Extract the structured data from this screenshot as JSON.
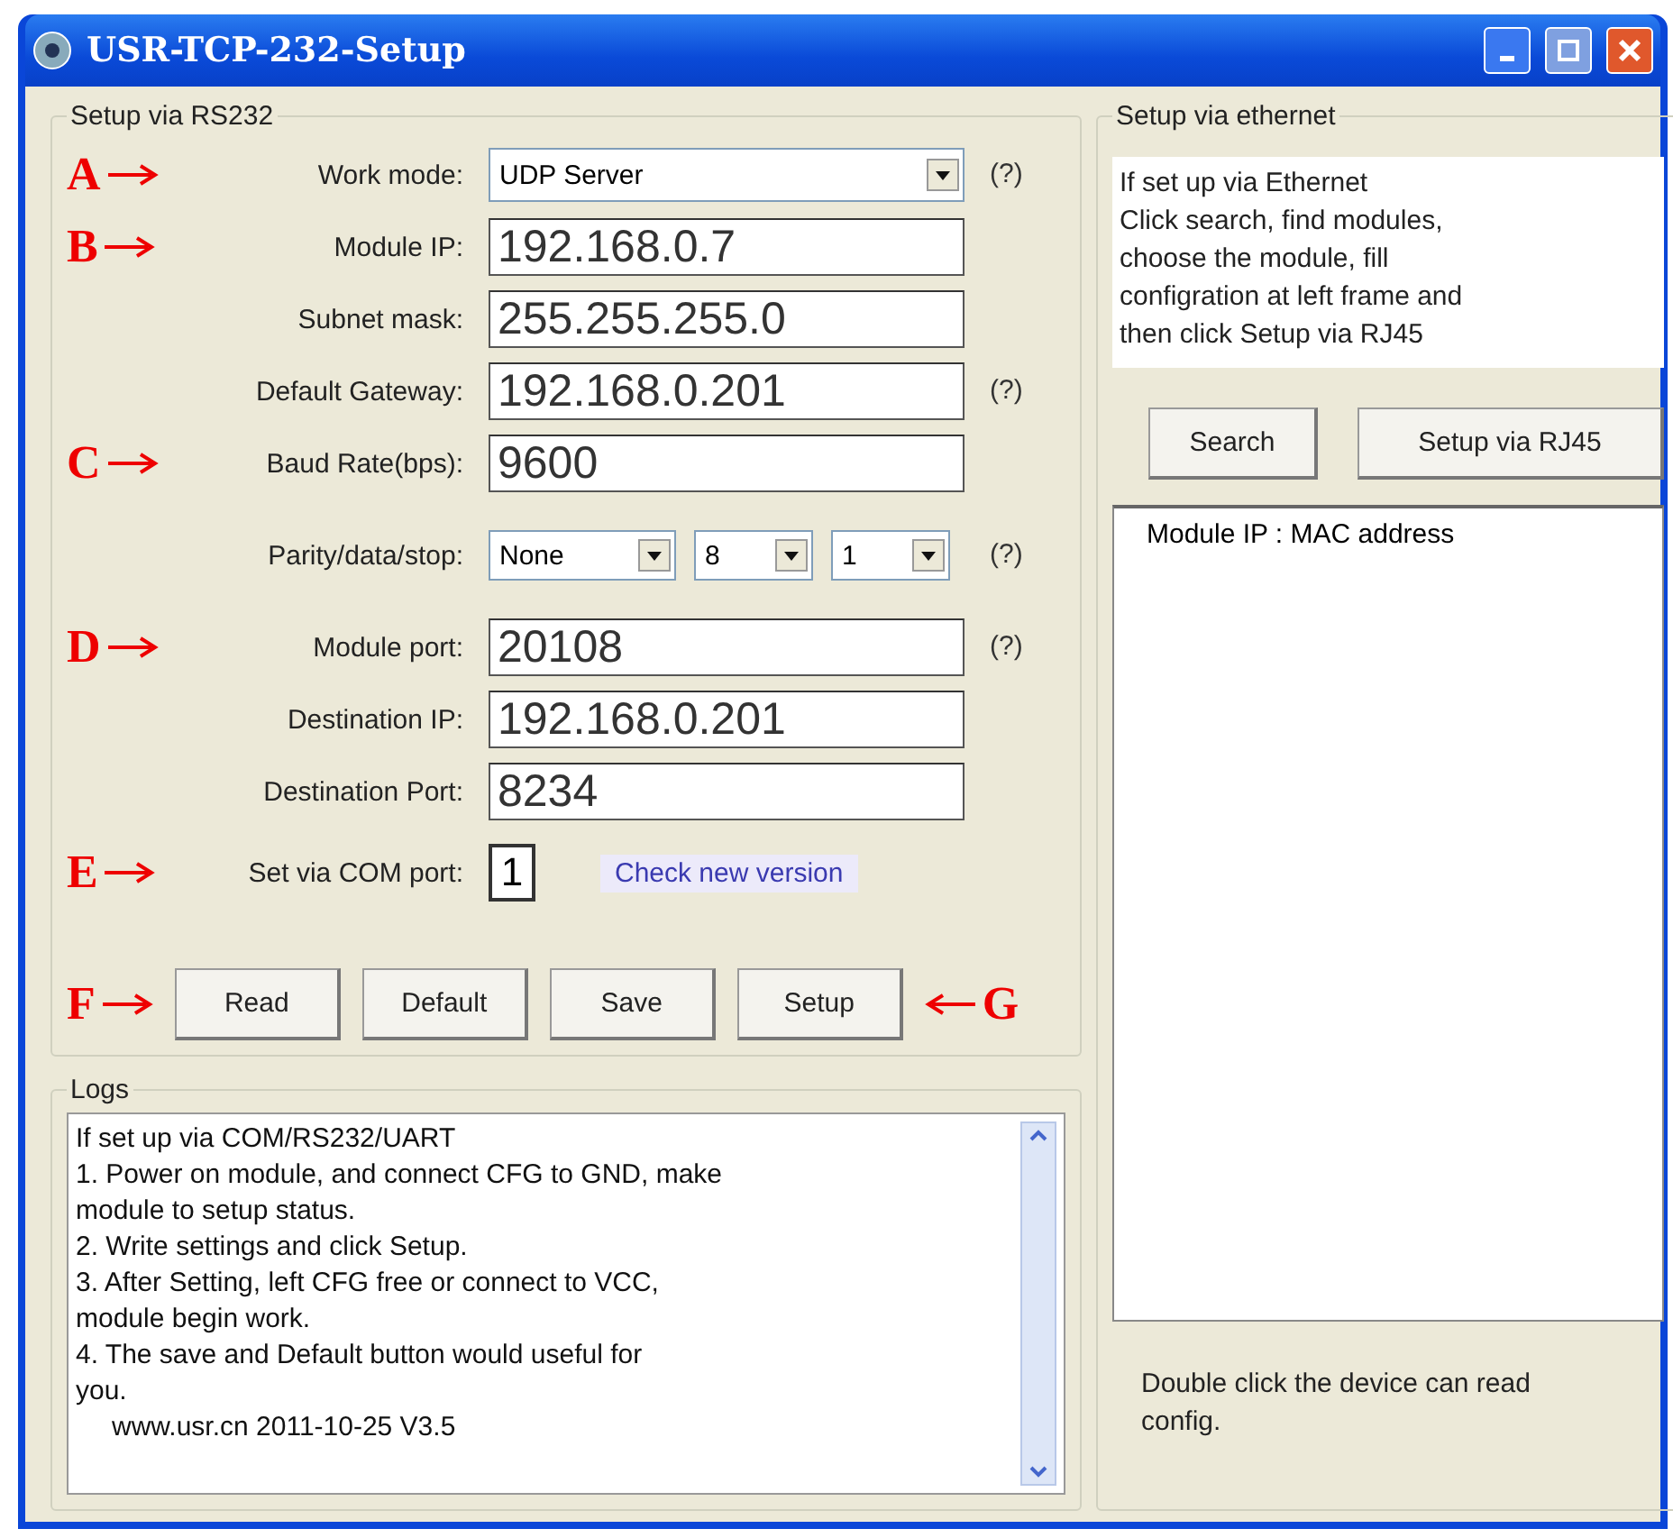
{
  "window": {
    "title": "USR-TCP-232-Setup"
  },
  "rs232": {
    "title": "Setup via RS232",
    "rows": [
      {
        "kind": "select",
        "label": "Work mode:",
        "value": "UDP Server",
        "help": "(?)",
        "callout": "A"
      },
      {
        "kind": "text",
        "label": "Module IP:",
        "value": "192.168.0.7",
        "callout": "B"
      },
      {
        "kind": "text",
        "label": "Subnet mask:",
        "value": "255.255.255.0"
      },
      {
        "kind": "text",
        "label": "Default Gateway:",
        "value": "192.168.0.201",
        "help": "(?)"
      },
      {
        "kind": "text",
        "label": "Baud Rate(bps):",
        "value": "9600",
        "callout": "C"
      },
      {
        "kind": "triple",
        "label": "Parity/data/stop:",
        "values": [
          "None",
          "8",
          "1"
        ],
        "help": "(?)"
      },
      {
        "kind": "text",
        "label": "Module port:",
        "value": "20108",
        "help": "(?)",
        "callout": "D"
      },
      {
        "kind": "text",
        "label": "Destination IP:",
        "value": "192.168.0.201"
      },
      {
        "kind": "text",
        "label": "Destination Port:",
        "value": "8234"
      }
    ],
    "com_port": {
      "label": "Set via COM port:",
      "value": "1",
      "callout": "E"
    },
    "link": "Check new version",
    "buttons": [
      {
        "label": "Read",
        "callout": "F"
      },
      {
        "label": "Default"
      },
      {
        "label": "Save"
      },
      {
        "label": "Setup",
        "callout": "G"
      }
    ]
  },
  "logs": {
    "title": "Logs",
    "lines": [
      "If set up via COM/RS232/UART",
      "1. Power on module, and connect CFG to GND, make",
      "module to setup status.",
      "2. Write settings and click Setup.",
      "3. After Setting, left CFG free or connect to VCC,",
      "module begin work.",
      "4. The save and Default button would useful for",
      "you.",
      "www.usr.cn 2011-10-25 V3.5"
    ]
  },
  "ethernet": {
    "title": "Setup via ethernet",
    "instructions": [
      "If set up via Ethernet",
      "Click search, find modules,",
      "choose the module, fill",
      "configration at left frame and",
      "then click Setup via RJ45"
    ],
    "buttons": [
      "Search",
      "Setup via RJ45"
    ],
    "list_header": "Module IP : MAC address",
    "note": "Double click the device can read config."
  }
}
